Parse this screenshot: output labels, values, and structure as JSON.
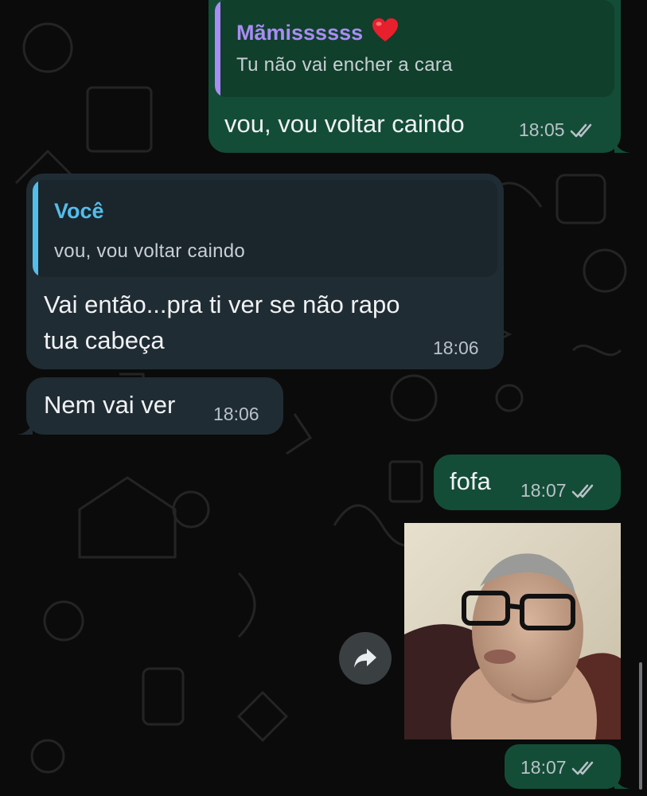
{
  "messages": [
    {
      "direction": "outgoing",
      "reply": {
        "author": "Mãmissssss",
        "author_emoji": "heart-emoji",
        "text": "Tu não vai encher a cara"
      },
      "text": "vou, vou voltar caindo",
      "time": "18:05",
      "status": "read"
    },
    {
      "direction": "incoming",
      "reply": {
        "author": "Você",
        "text": "vou, vou voltar caindo"
      },
      "lines": [
        "Vai então...pra ti  ver se não rapo",
        "tua cabeça"
      ],
      "time": "18:06"
    },
    {
      "direction": "incoming",
      "text": "Nem vai ver",
      "time": "18:06"
    },
    {
      "direction": "outgoing",
      "text": "fofa",
      "time": "18:07",
      "status": "read"
    },
    {
      "direction": "outgoing",
      "type": "photo",
      "time": "18:07",
      "status": "read"
    }
  ],
  "colors": {
    "outgoing_bubble": "#144d37",
    "incoming_bubble": "#202c33",
    "quote_outgoing_bg": "#103f2c",
    "quote_incoming_bg": "#1a252c",
    "quote_bar_mamis": "#a98cf5",
    "quote_bar_voce": "#53bdeb",
    "author_mamis": "#a98cf5",
    "author_voce": "#53bdeb",
    "read_ticks": "#b8c2c8"
  }
}
